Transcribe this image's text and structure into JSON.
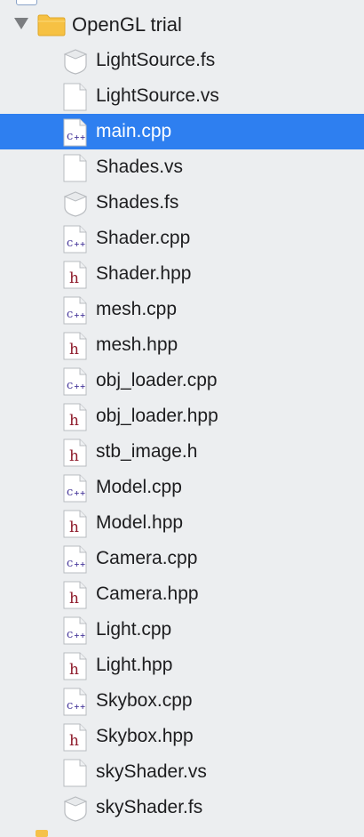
{
  "colors": {
    "selection": "#2e7ff0",
    "folder": "#f6c143",
    "cpp_mark": "#4a3b9c",
    "header_mark": "#8e1a2a"
  },
  "group": {
    "label": "OpenGL trial",
    "icon": "folder-icon",
    "expanded": true
  },
  "files": [
    {
      "name": "LightSource.fs",
      "icon": "shader-fs-icon",
      "kind": "fs",
      "selected": false
    },
    {
      "name": "LightSource.vs",
      "icon": "plain-file-icon",
      "kind": "vs",
      "selected": false
    },
    {
      "name": "main.cpp",
      "icon": "cpp-file-icon",
      "kind": "cpp",
      "selected": true
    },
    {
      "name": "Shades.vs",
      "icon": "plain-file-icon",
      "kind": "vs",
      "selected": false
    },
    {
      "name": "Shades.fs",
      "icon": "shader-fs-icon",
      "kind": "fs",
      "selected": false
    },
    {
      "name": "Shader.cpp",
      "icon": "cpp-file-icon",
      "kind": "cpp",
      "selected": false
    },
    {
      "name": "Shader.hpp",
      "icon": "header-file-icon",
      "kind": "h",
      "selected": false
    },
    {
      "name": "mesh.cpp",
      "icon": "cpp-file-icon",
      "kind": "cpp",
      "selected": false
    },
    {
      "name": "mesh.hpp",
      "icon": "header-file-icon",
      "kind": "h",
      "selected": false
    },
    {
      "name": "obj_loader.cpp",
      "icon": "cpp-file-icon",
      "kind": "cpp",
      "selected": false
    },
    {
      "name": "obj_loader.hpp",
      "icon": "header-file-icon",
      "kind": "h",
      "selected": false
    },
    {
      "name": "stb_image.h",
      "icon": "header-file-icon",
      "kind": "h",
      "selected": false
    },
    {
      "name": "Model.cpp",
      "icon": "cpp-file-icon",
      "kind": "cpp",
      "selected": false
    },
    {
      "name": "Model.hpp",
      "icon": "header-file-icon",
      "kind": "h",
      "selected": false
    },
    {
      "name": "Camera.cpp",
      "icon": "cpp-file-icon",
      "kind": "cpp",
      "selected": false
    },
    {
      "name": "Camera.hpp",
      "icon": "header-file-icon",
      "kind": "h",
      "selected": false
    },
    {
      "name": "Light.cpp",
      "icon": "cpp-file-icon",
      "kind": "cpp",
      "selected": false
    },
    {
      "name": "Light.hpp",
      "icon": "header-file-icon",
      "kind": "h",
      "selected": false
    },
    {
      "name": "Skybox.cpp",
      "icon": "cpp-file-icon",
      "kind": "cpp",
      "selected": false
    },
    {
      "name": "Skybox.hpp",
      "icon": "header-file-icon",
      "kind": "h",
      "selected": false
    },
    {
      "name": "skyShader.vs",
      "icon": "plain-file-icon",
      "kind": "vs",
      "selected": false
    },
    {
      "name": "skyShader.fs",
      "icon": "shader-fs-icon",
      "kind": "fs",
      "selected": false
    }
  ]
}
